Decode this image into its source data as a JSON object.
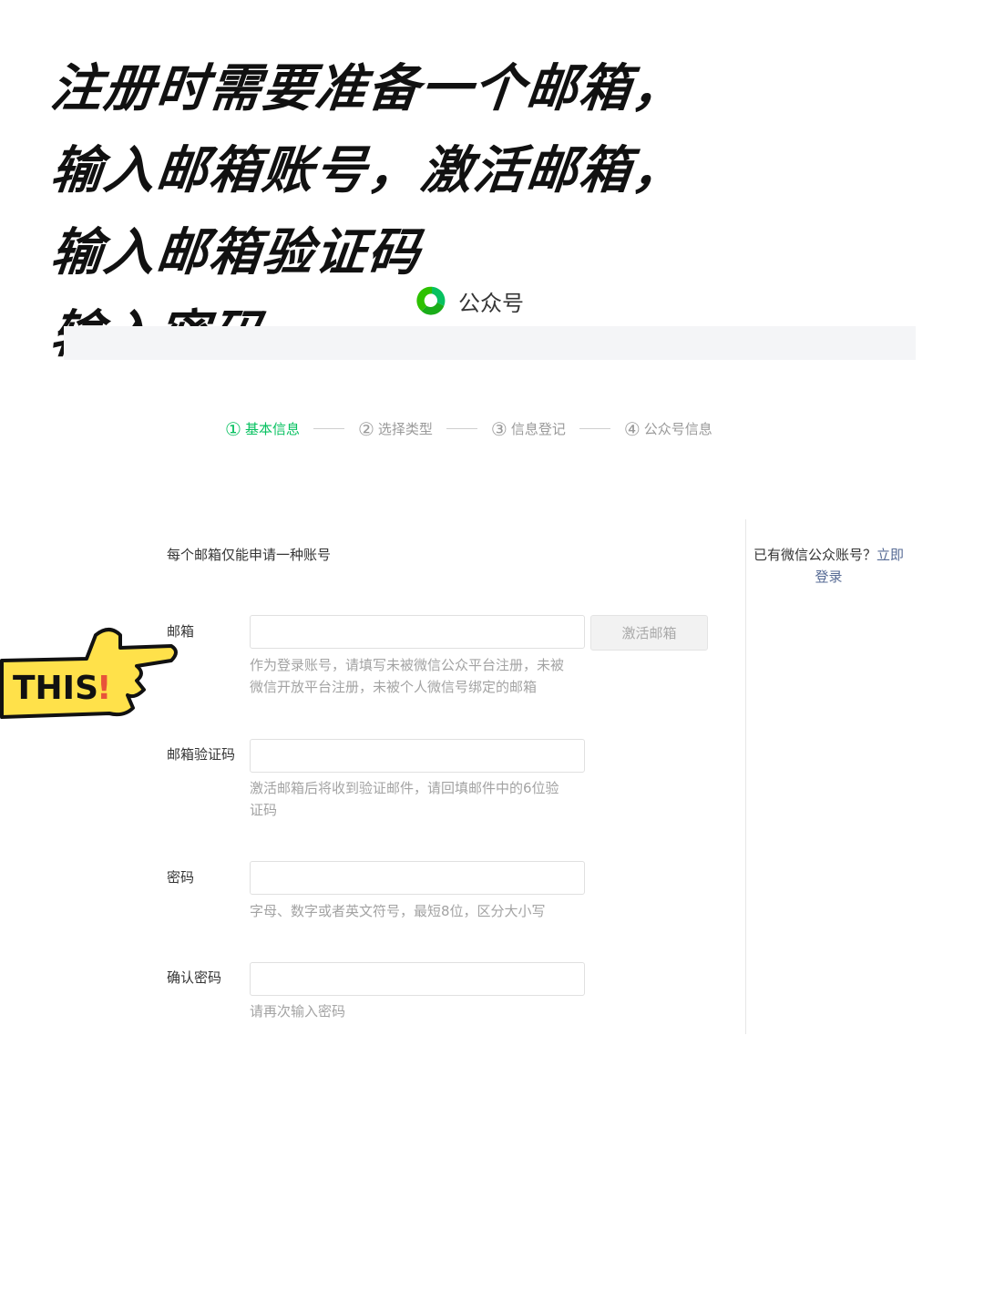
{
  "annotation": {
    "lines": [
      "注册时需要准备一个邮箱，",
      "输入邮箱账号，激活邮箱，",
      "输入邮箱验证码",
      "输入密码"
    ],
    "sticker_text": "THIS!"
  },
  "header": {
    "brand": "公众号",
    "logo_icon": "wechat-official-account-logo"
  },
  "steps": [
    {
      "num": "①",
      "label": "基本信息",
      "active": true
    },
    {
      "num": "②",
      "label": "选择类型",
      "active": false
    },
    {
      "num": "③",
      "label": "信息登记",
      "active": false
    },
    {
      "num": "④",
      "label": "公众号信息",
      "active": false
    }
  ],
  "form": {
    "intro": "每个邮箱仅能申请一种账号",
    "email": {
      "label": "邮箱",
      "value": "",
      "tip": "作为登录账号，请填写未被微信公众平台注册，未被微信开放平台注册，未被个人微信号绑定的邮箱",
      "activate_label": "激活邮箱"
    },
    "code": {
      "label": "邮箱验证码",
      "value": "",
      "tip": "激活邮箱后将收到验证邮件，请回填邮件中的6位验证码"
    },
    "password": {
      "label": "密码",
      "value": "",
      "tip": "字母、数字或者英文符号，最短8位，区分大小写"
    },
    "confirm": {
      "label": "确认密码",
      "value": "",
      "tip": "请再次输入密码"
    }
  },
  "side": {
    "text": "已有微信公众账号？",
    "login_link": "立即登录"
  },
  "colors": {
    "accent": "#07c160",
    "link": "#576b95",
    "sticker_yellow": "#ffe14a"
  }
}
